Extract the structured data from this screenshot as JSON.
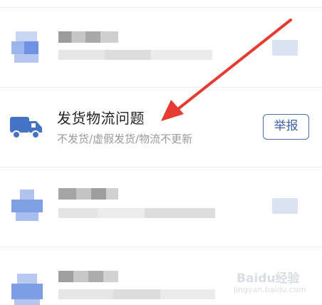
{
  "row_item": {
    "title": "发货物流问题",
    "subtitle": "不发货/虚假发货/物流不更新",
    "report_label": "举报",
    "icon": "truck-icon"
  },
  "colors": {
    "accent_blue": "#4472c4",
    "button_border": "#4a6fb0",
    "arrow_red": "#e53b30"
  },
  "watermark": {
    "text": "Baidu经验",
    "sub": "jingyan.baidu.com"
  }
}
